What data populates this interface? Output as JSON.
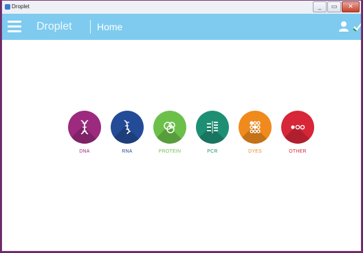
{
  "window": {
    "title": "Droplet"
  },
  "appbar": {
    "brand": "Droplet",
    "page_title": "Home"
  },
  "categories": [
    {
      "label": "DNA",
      "color": "#9c2a7e",
      "icon": "dna-helix-icon"
    },
    {
      "label": "RNA",
      "color": "#244b97",
      "icon": "rna-helix-icon"
    },
    {
      "label": "PROTEIN",
      "color": "#6cc04a",
      "icon": "protein-blob-icon"
    },
    {
      "label": "PCR",
      "color": "#1f8f74",
      "icon": "pcr-bars-icon"
    },
    {
      "label": "DYES",
      "color": "#f08a1d",
      "icon": "dye-dots-icon"
    },
    {
      "label": "OTHER",
      "color": "#d72637",
      "icon": "three-dots-icon"
    }
  ]
}
